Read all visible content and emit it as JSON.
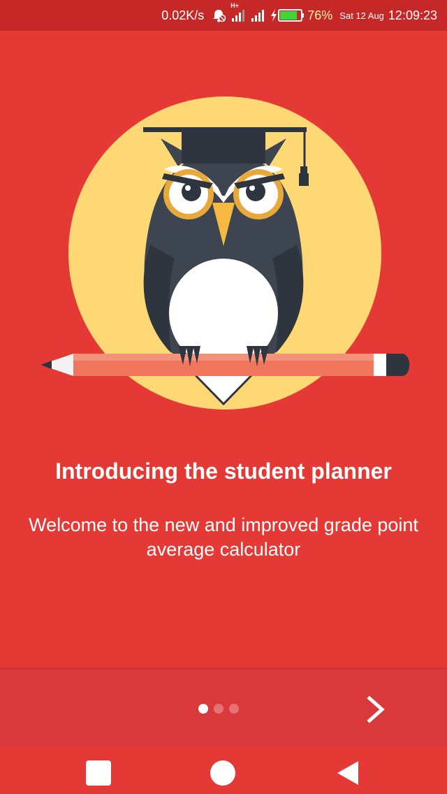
{
  "status_bar": {
    "net_speed": "0.02K/s",
    "network_type": "H+",
    "battery_percent": "76%",
    "date": "Sat 12 Aug",
    "time": "12:09:23",
    "icons": [
      "alarm-off-icon",
      "signal-icon",
      "signal-icon",
      "charging-icon",
      "battery-icon"
    ]
  },
  "onboarding": {
    "title": "Introducing the student planner",
    "subtitle": "Welcome to the new and improved grade point average calculator",
    "page_count": 3,
    "current_page": 1
  },
  "nav": {
    "next_icon": "chevron-right-icon",
    "recents_icon": "square-icon",
    "home_icon": "circle-icon",
    "back_icon": "back-triangle-icon"
  },
  "colors": {
    "background": "#E53935",
    "status_bar": "#C62828",
    "sun_circle": "#FDD874",
    "owl_body": "#3D4550",
    "pencil": "#F0765E"
  }
}
